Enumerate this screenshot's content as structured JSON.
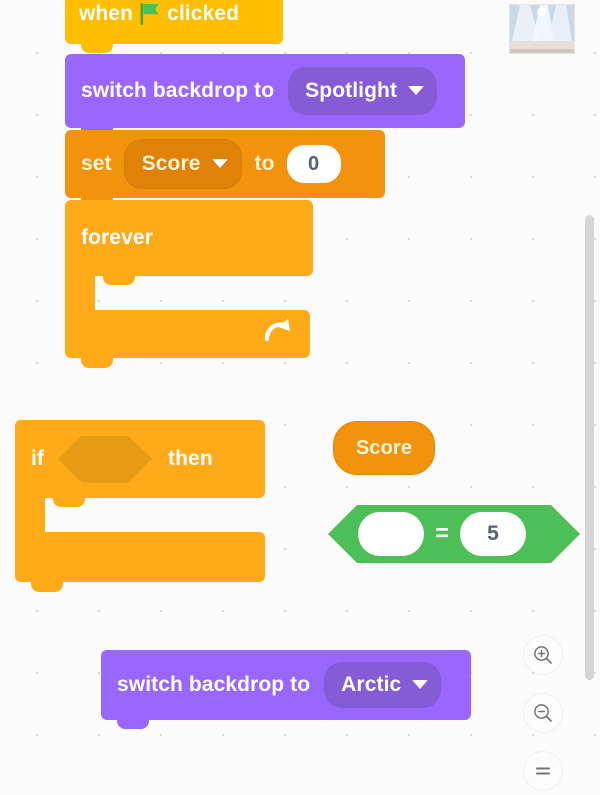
{
  "app": {
    "name": "Scratch block editor workspace",
    "canvas_background": "#fbfbfb"
  },
  "colors": {
    "events_yellow": "#ffbf00",
    "looks_purple": "#9966ff",
    "looks_purple_dark": "#855cd6",
    "variables_orange": "#f2930d",
    "variables_orange_dark": "#e18208",
    "control_orange": "#ffab19",
    "control_orange_dark": "#e59b14",
    "operators_green": "#4cbf56",
    "input_text": "#575e75"
  },
  "scripts": {
    "main_stack": {
      "hat_block": {
        "name": "when-green-flag-clicked",
        "text_before": "when",
        "icon": "green-flag-icon",
        "text_after": "clicked"
      },
      "switch_backdrop_block": {
        "name": "switch-backdrop-to",
        "label": "switch backdrop to",
        "dropdown_value": "Spotlight",
        "dropdown_icon": "chevron-down-icon"
      },
      "set_variable_block": {
        "name": "set-variable-to",
        "label_set": "set",
        "variable": "Score",
        "variable_icon": "chevron-down-icon",
        "label_to": "to",
        "value": "0"
      },
      "forever_block": {
        "name": "forever-loop",
        "label": "forever",
        "icon": "loop-arrow-icon",
        "body": "empty"
      }
    },
    "if_block": {
      "name": "if-then",
      "label_if": "if",
      "condition": "empty",
      "label_then": "then",
      "body": "empty"
    },
    "score_reporter": {
      "name": "variable-reporter-score",
      "label": "Score"
    },
    "equals_operator": {
      "name": "equals-operator",
      "left_value": "",
      "operator": "=",
      "right_value": "5"
    },
    "switch_backdrop_arctic": {
      "name": "switch-backdrop-to",
      "label": "switch backdrop to",
      "dropdown_value": "Arctic",
      "dropdown_icon": "chevron-down-icon"
    }
  },
  "backdrop_thumbnail": {
    "name": "backdrop-thumbnail-spotlight",
    "alt": "Spotlight stage backdrop preview"
  },
  "zoom_controls": {
    "zoom_in": {
      "name": "zoom-in-button",
      "icon": "magnifier-plus-icon"
    },
    "zoom_out": {
      "name": "zoom-out-button",
      "icon": "magnifier-minus-icon"
    },
    "zoom_reset": {
      "name": "zoom-reset-button",
      "icon": "equals-icon"
    }
  },
  "scrollbar": {
    "name": "vertical-scrollbar",
    "orientation": "vertical"
  }
}
